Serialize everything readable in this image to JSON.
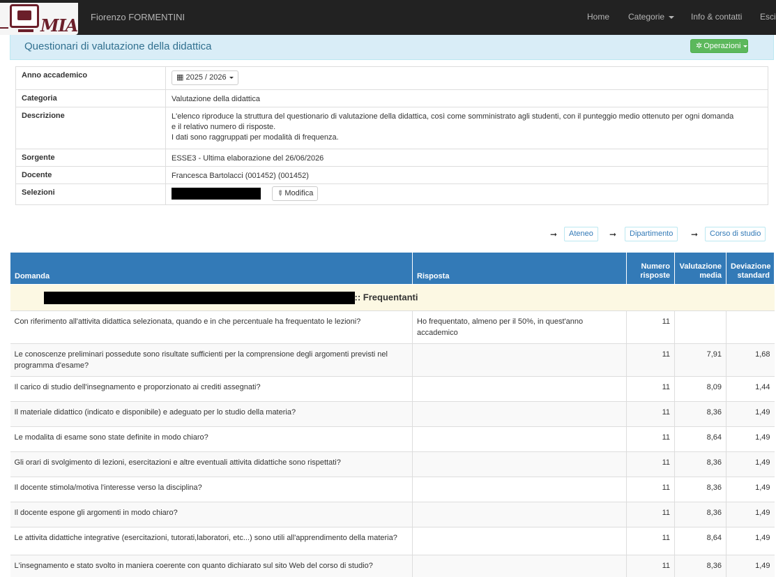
{
  "navbar": {
    "logo_text": "MIA",
    "user_name": "Fiorenzo FORMENTINI",
    "links": {
      "home": "Home",
      "categories": "Categorie",
      "info": "Info & contatti",
      "exit": "Esci"
    }
  },
  "header": {
    "title": "Questionari di valutazione della didattica",
    "operations_label": "Operazioni"
  },
  "info": {
    "rows": {
      "year": {
        "label": "Anno accademico",
        "value": "2025 / 2026"
      },
      "category": {
        "label": "Categoria",
        "value": "Valutazione della didattica"
      },
      "description": {
        "label": "Descrizione",
        "line1": "L'elenco riproduce la struttura del questionario di valutazione della didattica, così come somministrato agli studenti, con il punteggio medio ottenuto per ogni domanda",
        "line2": "e il relativo numero di risposte.",
        "line3": "I dati sono raggruppati per modalità di frequenza."
      },
      "source": {
        "label": "Sorgente",
        "value": "ESSE3 - Ultima elaborazione del 26/06/2026"
      },
      "teacher": {
        "label": "Docente",
        "value": "Francesca Bartolacci (001452) (001452)"
      },
      "selections": {
        "label": "Selezioni",
        "edit_label": "Modifica"
      }
    }
  },
  "filters": {
    "ateneo": "Ateneo",
    "department": "Dipartimento",
    "course": "Corso di studio"
  },
  "table": {
    "headers": {
      "question": "Domanda",
      "answer": "Risposta",
      "count_line1": "Numero",
      "count_line2": "risposte",
      "avg_line1": "Valutazione",
      "avg_line2": "media",
      "std_line1": "Deviazione",
      "std_line2": "standard"
    },
    "group_label": ":: Frequentanti",
    "rows": [
      {
        "question": "Con riferimento all'attivita didattica selezionata, quando e in che percentuale ha frequentato le lezioni?",
        "answer": "Ho frequentato, almeno per il 50%, in quest'anno accademico",
        "count": "11",
        "avg": "",
        "std": ""
      },
      {
        "question": "Le conoscenze preliminari possedute sono risultate sufficienti per la comprensione degli argomenti previsti nel programma d'esame?",
        "answer": "",
        "count": "11",
        "avg": "7,91",
        "std": "1,68"
      },
      {
        "question": "Il carico di studio dell'insegnamento e proporzionato ai crediti assegnati?",
        "answer": "",
        "count": "11",
        "avg": "8,09",
        "std": "1,44"
      },
      {
        "question": "Il materiale didattico (indicato e disponibile) e adeguato per lo studio della materia?",
        "answer": "",
        "count": "11",
        "avg": "8,36",
        "std": "1,49"
      },
      {
        "question": "Le modalita di esame sono state definite in modo chiaro?",
        "answer": "",
        "count": "11",
        "avg": "8,64",
        "std": "1,49"
      },
      {
        "question": "Gli orari di svolgimento di lezioni, esercitazioni e altre eventuali attivita didattiche sono rispettati?",
        "answer": "",
        "count": "11",
        "avg": "8,36",
        "std": "1,49"
      },
      {
        "question": "Il docente stimola/motiva l'interesse verso la disciplina?",
        "answer": "",
        "count": "11",
        "avg": "8,36",
        "std": "1,49"
      },
      {
        "question": "Il docente espone gli argomenti in modo chiaro?",
        "answer": "",
        "count": "11",
        "avg": "8,36",
        "std": "1,49"
      },
      {
        "question": "Le attivita didattiche integrative (esercitazioni, tutorati,laboratori, etc...) sono utili all'apprendimento della materia?",
        "answer": "",
        "count": "11",
        "avg": "8,64",
        "std": "1,49"
      },
      {
        "question": "L'insegnamento e stato svolto in maniera coerente con quanto dichiarato sul sito Web del corso di studio?",
        "answer": "",
        "count": "11",
        "avg": "8,36",
        "std": "1,49"
      }
    ]
  },
  "colors": {
    "navbar": "#222222",
    "panel_heading": "#d9edf7",
    "table_header": "#337ab7",
    "group_row": "#fcf8e3",
    "ops_button": "#5cb85c",
    "brand": "#6b1f2a"
  }
}
